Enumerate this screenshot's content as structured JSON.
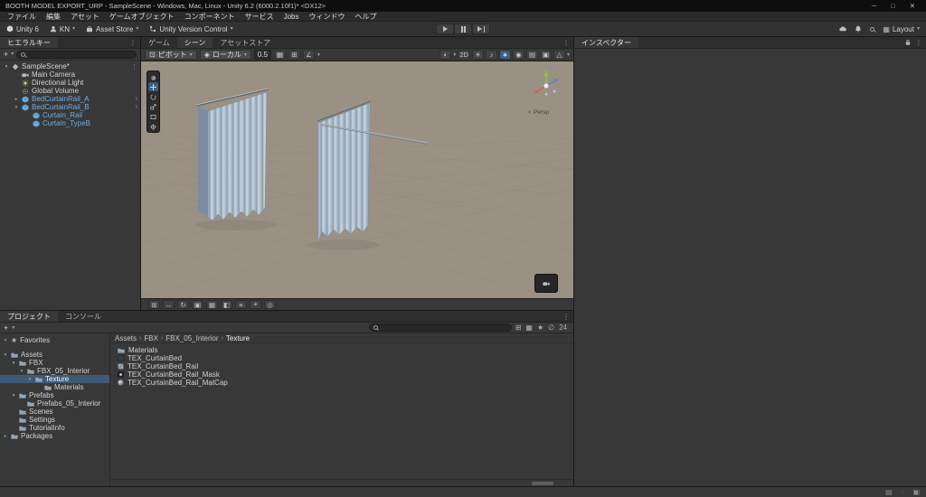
{
  "window": {
    "title": "BOOTH MODEL EXPORT_URP - SampleScene - Windows, Mac, Linux - Unity 6.2 (6000.2.10f1)* <DX12>",
    "controls": {
      "minimize": "─",
      "maximize": "□",
      "close": "✕"
    }
  },
  "menu_bar": {
    "items": [
      "ファイル",
      "編集",
      "アセット",
      "ゲームオブジェクト",
      "コンポーネント",
      "サービス",
      "Jobs",
      "ウィンドウ",
      "ヘルプ"
    ]
  },
  "toolbar": {
    "product": "Unity 6",
    "account": "KN",
    "asset_store": "Asset Store",
    "version_control": "Unity Version Control",
    "layout": "Layout"
  },
  "icons": {
    "caret": "▾",
    "fold_open": "▾",
    "fold_closed": "▸",
    "kebab": "⋮",
    "star": "★",
    "plus": "+",
    "chevron": "›",
    "pivot": "⊡",
    "local": "◈",
    "grid": "▦",
    "snap_move": "⊞",
    "snap_angle": "∠",
    "layout_grid": "▦",
    "hidden_filter": "∅",
    "status": [
      "▤",
      "◌",
      "▣"
    ]
  },
  "hierarchy": {
    "tab": "ヒエラルキー",
    "scene_row": "SampleScene*",
    "items": [
      {
        "label": "Main Camera"
      },
      {
        "label": "Directional Light"
      },
      {
        "label": "Global Volume"
      },
      {
        "label": "BedCurtainRail_A"
      },
      {
        "label": "BedCurtainRail_B"
      },
      {
        "label": "Curtain_Rail"
      },
      {
        "label": "Curtain_TypeB"
      }
    ]
  },
  "scene": {
    "tabs": [
      "ゲーム",
      "シーン",
      "アセットストア"
    ],
    "pivot": "ピボット",
    "orientation": "ローカル",
    "snap_increment": "0.5",
    "projection_marker": "<",
    "projection": "Persp",
    "view_icons": [
      "◐",
      "2D",
      "☀",
      "♪",
      "∗",
      "◉",
      "▤",
      "▣",
      "△"
    ],
    "strip_icons": [
      "⊞",
      "↔",
      "↻",
      "▣",
      "▦",
      "◧",
      "≡",
      "⌖",
      "◎"
    ],
    "colors": {
      "background": "#9a9184",
      "curtain_light": "#ccd5df",
      "curtain_mid": "#aabccb",
      "curtain_dark": "#8da0b2"
    }
  },
  "inspector": {
    "tab": "インスペクター"
  },
  "project": {
    "tabs": [
      "プロジェクト",
      "コンソール"
    ],
    "hidden_count": "24",
    "breadcrumb": [
      "Assets",
      "FBX",
      "FBX_05_Interior",
      "Texture"
    ],
    "tree": [
      {
        "label": "Favorites"
      },
      {
        "label": "Assets"
      },
      {
        "label": "FBX"
      },
      {
        "label": "FBX_05_Interior"
      },
      {
        "label": "Texture"
      },
      {
        "label": "Materials"
      },
      {
        "label": "Prefabs"
      },
      {
        "label": "Prefabs_05_Interior"
      },
      {
        "label": "Scenes"
      },
      {
        "label": "Settings"
      },
      {
        "label": "TutorialInfo"
      },
      {
        "label": "Packages"
      }
    ],
    "files": [
      {
        "label": "Materials"
      },
      {
        "label": "TEX_CurtainBed"
      },
      {
        "label": "TEX_CurtainBed_Rail"
      },
      {
        "label": "TEX_CurtainBed_Rail_Mask"
      },
      {
        "label": "TEX_CurtainBed_Rail_MatCap"
      }
    ]
  }
}
